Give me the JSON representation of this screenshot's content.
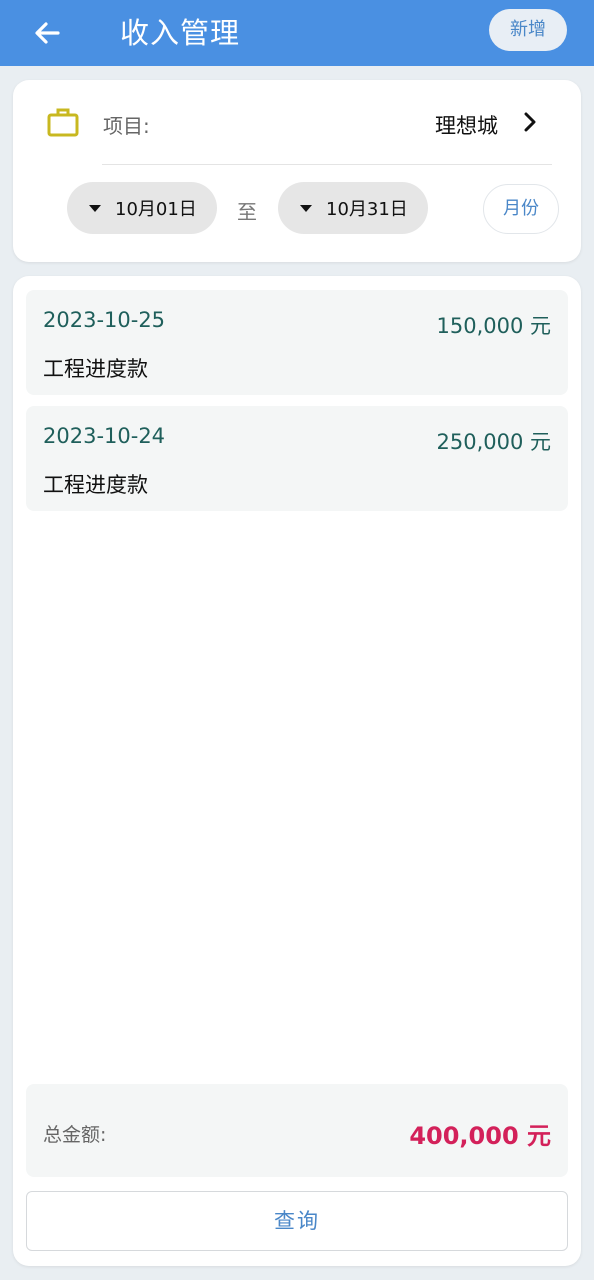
{
  "header": {
    "title": "收入管理",
    "add_label": "新增"
  },
  "filter": {
    "project_label": "项目:",
    "project_value": "理想城",
    "start_date": "10月01日",
    "to_label": "至",
    "end_date": "10月31日",
    "month_label": "月份"
  },
  "records": [
    {
      "date": "2023-10-25",
      "amount": "150,000 元",
      "description": "工程进度款"
    },
    {
      "date": "2023-10-24",
      "amount": "250,000 元",
      "description": "工程进度款"
    }
  ],
  "summary": {
    "total_label": "总金额:",
    "total_value": "400,000 元"
  },
  "actions": {
    "query_label": "查询"
  },
  "colors": {
    "appbar": "#4a90e2",
    "accent_blue": "#4a87c8",
    "teal_text": "#1f5f5b",
    "total_red": "#d3215a",
    "briefcase_yellow": "#c8b820"
  },
  "icons": {
    "back": "arrow-left-icon",
    "project": "briefcase-icon",
    "project_select": "chevron-right-icon",
    "date_dropdown": "caret-down-icon"
  }
}
